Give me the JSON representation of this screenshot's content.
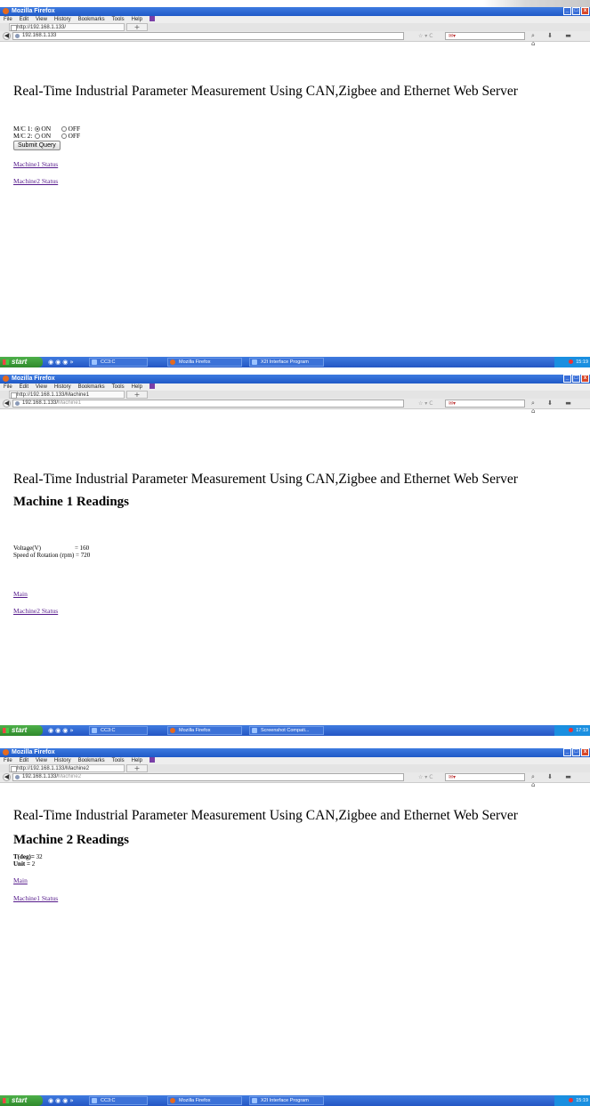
{
  "browser": {
    "window_title": "Mozilla Firefox",
    "menu": [
      "File",
      "Edit",
      "View",
      "History",
      "Bookmarks",
      "Tools",
      "Help"
    ],
    "new_tab": "+",
    "nav_right": "☆ ▾ C",
    "search_placeholder": "✉▾",
    "nav_icons": "⌕ ⬇ ▬ ⌂"
  },
  "page_heading": "Real-Time Industrial Parameter Measurement Using CAN,Zigbee and Ethernet Web Server",
  "screens": [
    {
      "tab_label": "http://192.168.1.133/",
      "url": "192.168.1.133",
      "url_suffix": "",
      "form": {
        "mc1_label": "M/C 1:",
        "mc2_label": "M/C 2:",
        "on_label": "ON",
        "off_label": "OFF",
        "submit_label": "Submit Query",
        "mc1_selected": "ON",
        "mc2_selected": "none"
      },
      "links": [
        "Machine1 Status",
        "Machine2 Status"
      ],
      "taskbar": {
        "start": "start",
        "tasks": [
          "CC3:C",
          "Mozilla Firefox",
          "X2I Interface Program"
        ],
        "clock": "15:19"
      }
    },
    {
      "tab_label": "http://192.168.1.133/Machine1",
      "url": "192.168.1.133/",
      "url_suffix": "Machine1",
      "section_title": "Machine 1 Readings",
      "readings": [
        {
          "label": "Voltage(V)",
          "value": "= 160"
        },
        {
          "label": "Speed of Rotation (rpm)",
          "value": "= 720"
        }
      ],
      "links": [
        "Main",
        "Machine2 Status"
      ],
      "taskbar": {
        "start": "start",
        "tasks": [
          "CC3:C",
          "Mozilla Firefox",
          "Screenshot Compati..."
        ],
        "clock": "17:19"
      }
    },
    {
      "tab_label": "http://192.168.1.133/Machine2",
      "url": "192.168.1.133/",
      "url_suffix": "Machine2",
      "section_title": "Machine 2 Readings",
      "readings": [
        {
          "label": "T(deg)=",
          "value": "32"
        },
        {
          "label": "Unit =",
          "value": "2"
        }
      ],
      "links": [
        "Main",
        "Machine1 Status"
      ],
      "taskbar": {
        "start": "start",
        "tasks": [
          "CC3:C",
          "Mozilla Firefox",
          "X2I Interface Program"
        ],
        "clock": "15:19"
      }
    }
  ]
}
